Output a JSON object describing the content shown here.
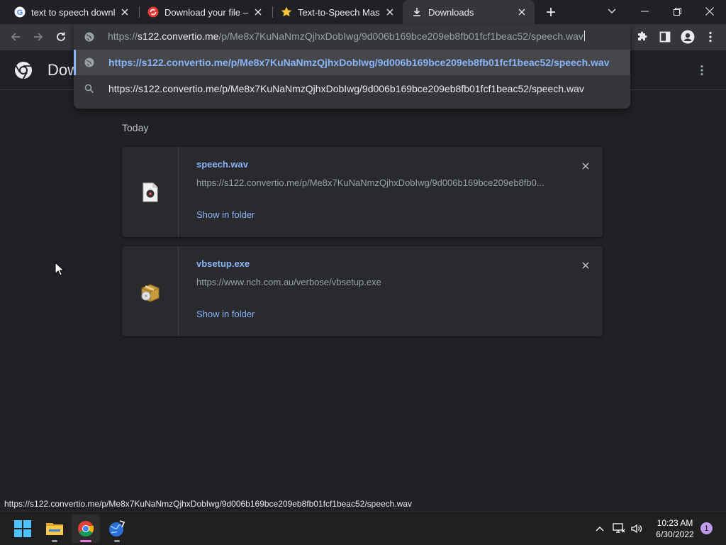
{
  "tabs": [
    {
      "title": "text to speech download",
      "icon": "google-icon"
    },
    {
      "title": "Download your file — Convertio",
      "icon": "convertio-icon"
    },
    {
      "title": "Text-to-Speech Master",
      "icon": "star-icon"
    },
    {
      "title": "Downloads",
      "icon": "download-icon",
      "active": true
    }
  ],
  "omnibox": {
    "scheme": "https://",
    "host": "s122.convertio.me",
    "path": "/p/Me8x7KuNaNmzQjhxDobIwg/9d006b169bce209eb8fb01fcf1beac52/speech.wav",
    "suggestions": [
      {
        "text": "https://s122.convertio.me/p/Me8x7KuNaNmzQjhxDobIwg/9d006b169bce209eb8fb01fcf1beac52/speech.wav",
        "icon": "globe-icon"
      },
      {
        "text": "https://s122.convertio.me/p/Me8x7KuNaNmzQjhxDobIwg/9d006b169bce209eb8fb01fcf1beac52/speech.wav",
        "icon": "search-icon"
      }
    ]
  },
  "downloads_page": {
    "title": "Downloads",
    "section_label": "Today",
    "items": [
      {
        "name": "speech.wav",
        "url": "https://s122.convertio.me/p/Me8x7KuNaNmzQjhxDobIwg/9d006b169bce209eb8fb0...",
        "action": "Show in folder",
        "icon": "audio-file-icon"
      },
      {
        "name": "vbsetup.exe",
        "url": "https://www.nch.com.au/verbose/vbsetup.exe",
        "action": "Show in folder",
        "icon": "installer-package-icon"
      }
    ]
  },
  "status_bar": "https://s122.convertio.me/p/Me8x7KuNaNmzQjhxDobIwg/9d006b169bce209eb8fb01fcf1beac52/speech.wav",
  "taskbar": {
    "time": "10:23 AM",
    "date": "6/30/2022",
    "notification_count": "1"
  },
  "colors": {
    "accent": "#8ab4f8",
    "background": "#202124",
    "toolbar": "#35363a"
  }
}
